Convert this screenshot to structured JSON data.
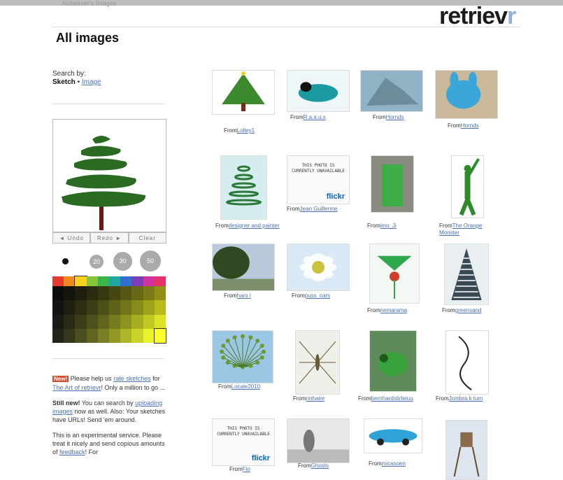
{
  "header": {
    "top_link": "Alzheimer's Images",
    "logo_main": "retriev",
    "logo_accent": "r",
    "page_title": "All images"
  },
  "sidebar": {
    "search_by_label": "Search by:",
    "sketch_label": "Sketch",
    "separator": " • ",
    "image_link": "Image",
    "buttons": {
      "undo": "◄ Undo",
      "redo": "Redo ►",
      "clear": "Clear"
    },
    "brush_sizes": [
      "",
      "20",
      "30",
      "50"
    ],
    "palette_top": [
      "#e53b2c",
      "#f18a1c",
      "#f5d21e",
      "#86c43a",
      "#3ab54a",
      "#22a7a0",
      "#2e6fd0",
      "#7a3fb8",
      "#d2329b",
      "#e5336a"
    ],
    "news": [
      {
        "badge": "New!",
        "text": "Please help us",
        "link": "rate sketches",
        "text2": "for",
        "link2": "The Art of retrievr",
        "text3": "! Only a million to go ..."
      },
      {
        "bold": "Still new!",
        "text": "You can search by",
        "link": "uploading images",
        "text2": "now as well. Also: Your sketches have URLs! Send 'em around."
      },
      {
        "text": "This is an experimental service. Please treat it nicely and send copious amounts of",
        "link": "feedback",
        "text2": "! For"
      }
    ]
  },
  "results": [
    {
      "from": "From",
      "user": "Lolley1",
      "kind": "tree"
    },
    {
      "from": "From",
      "user": "R.a.a.u.s",
      "kind": "blue-dragon"
    },
    {
      "from": "From",
      "user": "Hornds",
      "kind": "gray"
    },
    {
      "from": "From",
      "user": "Hornds",
      "kind": "blue-toy"
    },
    {
      "from": "From",
      "user": "designer and painter",
      "kind": "spiral"
    },
    {
      "from": "From",
      "user": "Jean Guillerme",
      "kind": "flickr",
      "unavailable": "This photo is currently unavailable",
      "brand": "flickr"
    },
    {
      "from": "From",
      "user": "imo_Ji",
      "kind": "door"
    },
    {
      "from": "From",
      "user": "The Orange Monster",
      "kind": "green-man"
    },
    {
      "from": "From",
      "user": "haro l",
      "kind": "landscape"
    },
    {
      "from": "From",
      "user": "puss_cars",
      "kind": "flower"
    },
    {
      "from": "From",
      "user": "nemarama",
      "kind": "plant"
    },
    {
      "from": "From",
      "user": "greensand",
      "kind": "tower"
    },
    {
      "from": "From",
      "user": "Locale2010",
      "kind": "dandelion"
    },
    {
      "from": "From",
      "user": "rinhaire",
      "kind": "insect"
    },
    {
      "from": "From",
      "user": "bernhardstirteiuu",
      "kind": "grasshopper"
    },
    {
      "from": "From",
      "user": "Jombra k tum",
      "kind": "sketch"
    },
    {
      "from": "From",
      "user": "Fio",
      "kind": "flickr",
      "unavailable": "This photo is currently unavailable",
      "brand": "flickr"
    },
    {
      "from": "From",
      "user": "Ghosts",
      "kind": "statue"
    },
    {
      "from": "From",
      "user": "micasoen",
      "kind": "car"
    },
    {
      "from": "From",
      "user": "",
      "kind": "tower2"
    }
  ]
}
